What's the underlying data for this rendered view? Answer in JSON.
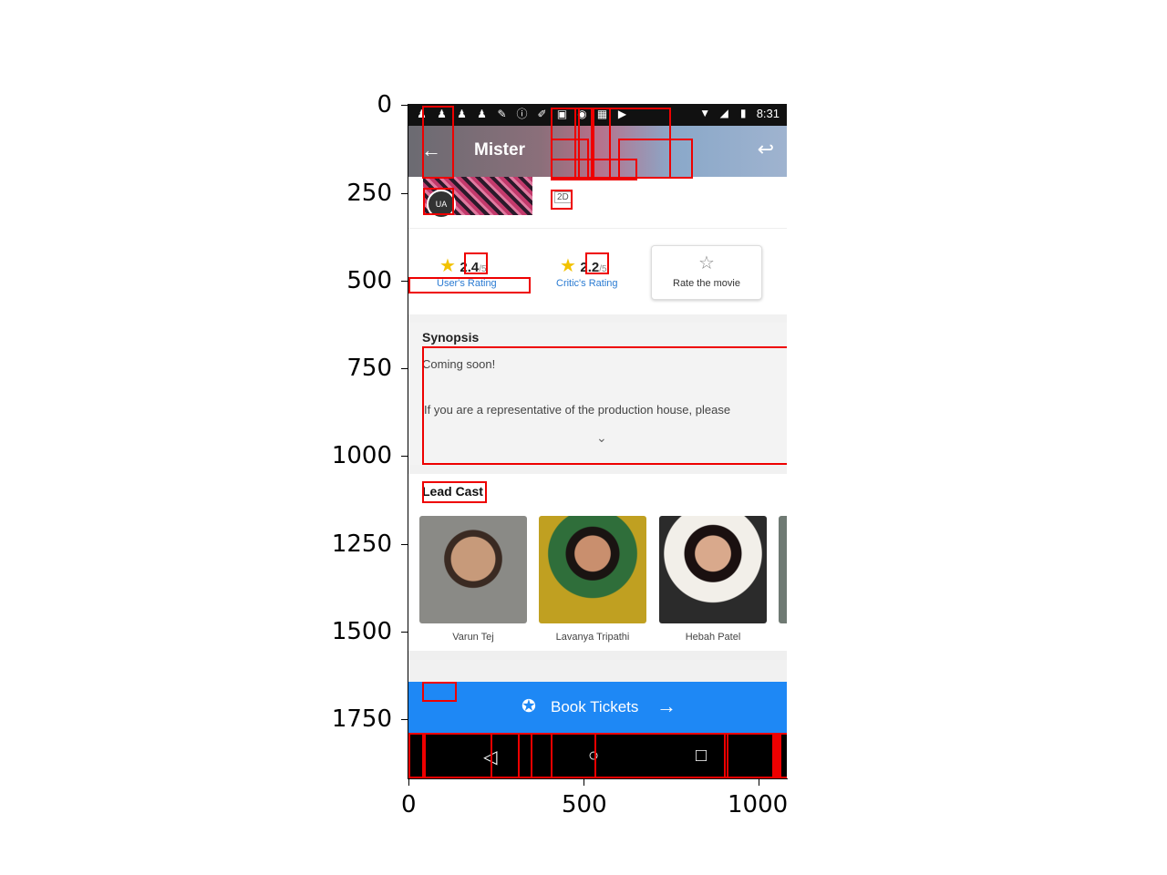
{
  "axes": {
    "y_ticks": [
      "0",
      "250",
      "500",
      "750",
      "1000",
      "1250",
      "1500",
      "1750"
    ],
    "x_ticks": [
      "0",
      "500",
      "1000"
    ]
  },
  "status_bar": {
    "time": "8:31",
    "icons": [
      "person-icon",
      "person-icon",
      "person-icon",
      "person-icon",
      "note-icon",
      "info-icon",
      "pen-icon",
      "lock-icon",
      "shield-icon",
      "calendar-icon",
      "youtube-icon",
      "wifi-icon",
      "signal-icon",
      "battery-icon"
    ]
  },
  "app_bar": {
    "title": "Mister",
    "back_icon": "arrow-left-icon",
    "share_icon": "reply-icon"
  },
  "movie": {
    "certificate": "UA",
    "format": "2D"
  },
  "ratings": {
    "users": {
      "value": "2.4",
      "out_of": "/5",
      "label": "User's Rating"
    },
    "critics": {
      "value": "2.2",
      "out_of": "/5",
      "label": "Critic's Rating"
    },
    "rate_button": "Rate the movie"
  },
  "synopsis": {
    "heading": "Synopsis",
    "line1": "Coming soon!",
    "line2": "If you are a representative of the production house, please"
  },
  "cast": {
    "heading": "Lead Cast",
    "members": [
      {
        "name": "Varun Tej"
      },
      {
        "name": "Lavanya Tripathi"
      },
      {
        "name": "Hebah Patel"
      }
    ]
  },
  "booking": {
    "label": "Book Tickets",
    "icon": "ticket-icon"
  },
  "nav": {
    "icons": [
      "back-triangle-icon",
      "home-circle-icon",
      "recents-square-icon"
    ]
  },
  "colors": {
    "accent": "#1e88f5",
    "link": "#2a7bd2",
    "star": "#f2c200",
    "annotation": "#ee0000"
  }
}
